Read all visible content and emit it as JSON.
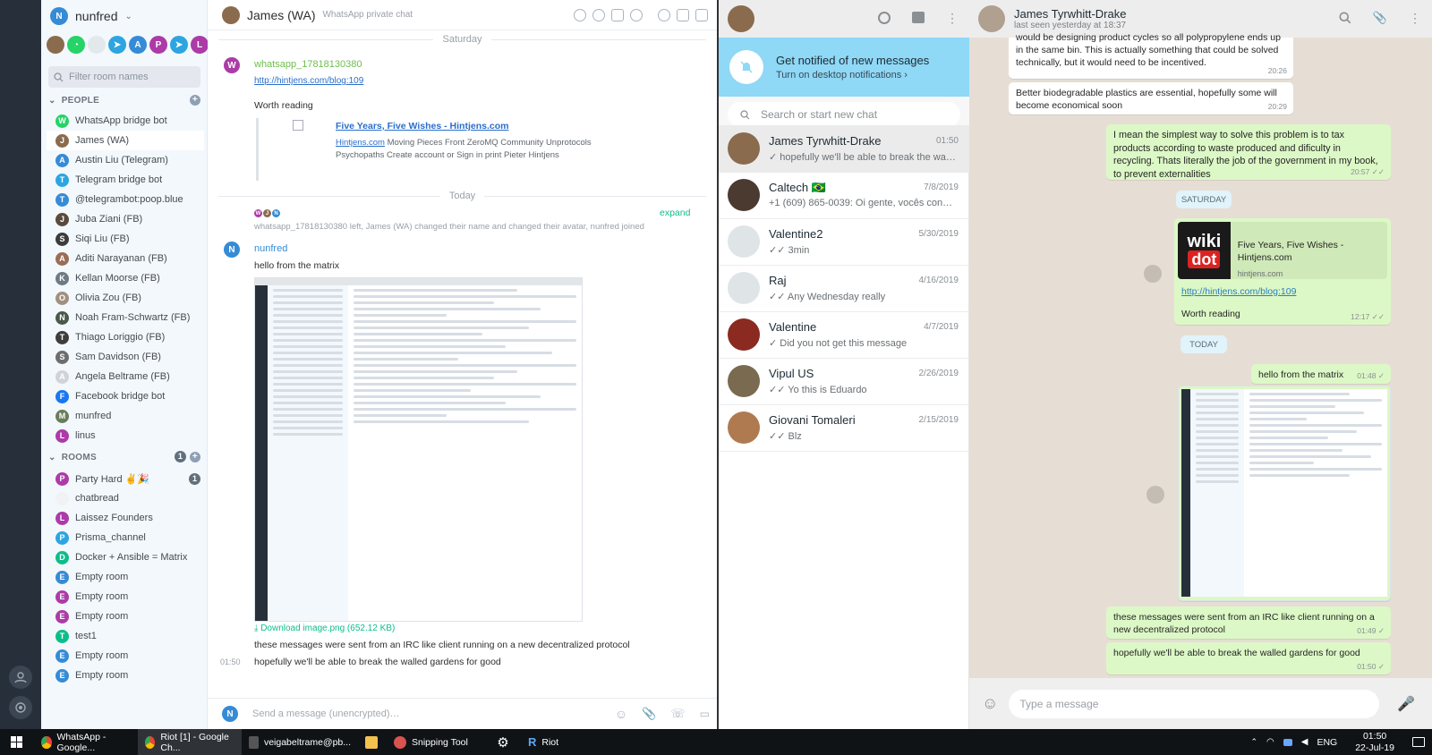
{
  "riot": {
    "user": {
      "name": "nunfred",
      "initial": "N"
    },
    "filter_placeholder": "Filter room names",
    "people_header": "PEOPLE",
    "rooms_header": "ROOMS",
    "rooms_badge": "1",
    "people": [
      {
        "name": "WhatsApp bridge bot",
        "initial": "W",
        "color": "#25d366"
      },
      {
        "name": "James (WA)",
        "initial": "J",
        "color": "#8a6b4e",
        "selected": true
      },
      {
        "name": "Austin Liu (Telegram)",
        "initial": "A",
        "color": "#368bd6"
      },
      {
        "name": "Telegram bridge bot",
        "initial": "T",
        "color": "#2ca5e0"
      },
      {
        "name": "@telegrambot:poop.blue",
        "initial": "T",
        "color": "#368bd6"
      },
      {
        "name": "Juba Ziani (FB)",
        "initial": "J",
        "color": "#5b4a3c"
      },
      {
        "name": "Siqi Liu (FB)",
        "initial": "S",
        "color": "#3c3c3c"
      },
      {
        "name": "Aditi Narayanan (FB)",
        "initial": "A",
        "color": "#9a6d55"
      },
      {
        "name": "Kellan Moorse (FB)",
        "initial": "K",
        "color": "#6d7a85"
      },
      {
        "name": "Olivia Zou (FB)",
        "initial": "O",
        "color": "#a09080"
      },
      {
        "name": "Noah Fram-Schwartz (FB)",
        "initial": "N",
        "color": "#4a5a4a"
      },
      {
        "name": "Thiago Loriggio (FB)",
        "initial": "T",
        "color": "#3d3d3d"
      },
      {
        "name": "Sam Davidson (FB)",
        "initial": "S",
        "color": "#6d6d6d"
      },
      {
        "name": "Angela Beltrame (FB)",
        "initial": "A",
        "color": "#d0d4d8"
      },
      {
        "name": "Facebook bridge bot",
        "initial": "F",
        "color": "#1877f2"
      },
      {
        "name": "munfred",
        "initial": "M",
        "color": "#6a7d5a"
      },
      {
        "name": "linus",
        "initial": "L",
        "color": "#ac3ba8"
      }
    ],
    "rooms": [
      {
        "name": "Party Hard ✌🎉",
        "initial": "P",
        "color": "#ac3ba8",
        "badge": "1"
      },
      {
        "name": "chatbread",
        "initial": "",
        "color": "#f0f2f4"
      },
      {
        "name": "Laissez Founders",
        "initial": "L",
        "color": "#ac3ba8"
      },
      {
        "name": "Prisma_channel",
        "initial": "P",
        "color": "#2ca5e0"
      },
      {
        "name": "Docker + Ansible = Matrix",
        "initial": "D",
        "color": "#0dbd8b"
      },
      {
        "name": "Empty room",
        "initial": "E",
        "color": "#368bd6"
      },
      {
        "name": "Empty room",
        "initial": "E",
        "color": "#ac3ba8"
      },
      {
        "name": "Empty room",
        "initial": "E",
        "color": "#ac3ba8"
      },
      {
        "name": "test1",
        "initial": "T",
        "color": "#0dbd8b"
      },
      {
        "name": "Empty room",
        "initial": "E",
        "color": "#368bd6"
      },
      {
        "name": "Empty room",
        "initial": "E",
        "color": "#368bd6"
      }
    ],
    "chat": {
      "title": "James (WA)",
      "topic": "WhatsApp private chat",
      "day1": "Saturday",
      "day2": "Today",
      "msg1_sender": "whatsapp_17818130380",
      "msg1_link": "http://hintjens.com/blog:109",
      "msg1_text": "Worth reading",
      "preview_title": "Five Years, Five Wishes - Hintjens.com",
      "preview_site": "Hintjens.com",
      "preview_desc1": "Moving Pieces Front ZeroMQ Community Unprotocols",
      "preview_desc2": "Psychopaths Create account or Sign in print Pieter Hintjens",
      "membership": "whatsapp_17818130380 left, James (WA) changed their name and changed their avatar, nunfred joined",
      "expand": "expand",
      "msg2_sender": "nunfred",
      "msg2_text": "hello from the matrix",
      "download": "Download image.png (652.12 KB)",
      "msg3": "these messages were sent from an IRC like client running on a new decentralized protocol",
      "msg4_time": "01:50",
      "msg4": "hopefully we'll be able to break the walled gardens for good",
      "composer_placeholder": "Send a message (unencrypted)…"
    }
  },
  "whatsapp": {
    "notif_title": "Get notified of new messages",
    "notif_sub": "Turn on desktop notifications ›",
    "search_placeholder": "Search or start new chat",
    "chats": [
      {
        "name": "James Tyrwhitt-Drake",
        "date": "01:50",
        "preview": "✓ hopefully we'll be able to break the walle...",
        "color": "#8a6b4e",
        "selected": true
      },
      {
        "name": "Caltech 🇧🇷",
        "date": "7/8/2019",
        "preview": "+1 (609) 865-0039: Oi gente, vocês conhece...",
        "color": "#4a3a30"
      },
      {
        "name": "Valentine2",
        "date": "5/30/2019",
        "preview": "✓✓ 3min",
        "color": "#dfe5e7"
      },
      {
        "name": "Raj",
        "date": "4/16/2019",
        "preview": "✓✓ Any Wednesday really",
        "color": "#dfe5e7"
      },
      {
        "name": "Valentine",
        "date": "4/7/2019",
        "preview": "✓ Did you not get this message",
        "color": "#8a2a20"
      },
      {
        "name": "Vipul US",
        "date": "2/26/2019",
        "preview": "✓✓ Yo this is Eduardo",
        "color": "#7a6a50"
      },
      {
        "name": "Giovani Tomaleri",
        "date": "2/15/2019",
        "preview": "✓✓ Blz",
        "color": "#b07a50"
      }
    ],
    "conv": {
      "name": "James Tyrwhitt-Drake",
      "last_seen": "last seen yesterday at 18:37",
      "in1": "would be designing product cycles so all polypropylene ends up in the same bin.  This is actually something that could be solved technically, but it would need to be incentived.",
      "in1_time": "20:26",
      "in2": "Better biodegradable  plastics are essential, hopefully some will become economical soon",
      "in2_time": "20:29",
      "out1": "I mean the simplest way to solve this problem is to tax products according to waste produced and dificulty in recycling. Thats literally the job of the government in my book, to prevent externalities",
      "out1_time": "20:57 ✓✓",
      "day1": "SATURDAY",
      "link_logo_top": "wiki",
      "link_logo_bottom": "dot",
      "link_title": "Five Years, Five Wishes - Hintjens.com",
      "link_site": "hintjens.com",
      "link_url": "http://hintjens.com/blog:109",
      "link_text": "Worth reading",
      "link_time": "12:17 ✓✓",
      "day2": "TODAY",
      "out2": "hello from the matrix",
      "out2_time": "01:48 ✓",
      "img_time": "01:49 ✓",
      "out3": "these messages were sent from an IRC like client running on a new decentralized protocol",
      "out3_time": "01:49 ✓",
      "out4": "hopefully we'll be able to break the walled gardens for good",
      "out4_time": "01:50 ✓",
      "composer_placeholder": "Type a message"
    }
  },
  "taskbar": {
    "items": [
      "WhatsApp - Google...",
      "Riot [1] - Google Ch...",
      "veigabeltrame@pb...",
      "Snipping Tool",
      "",
      "Riot"
    ],
    "lang": "ENG",
    "time": "01:50",
    "date": "22-Jul-19"
  }
}
